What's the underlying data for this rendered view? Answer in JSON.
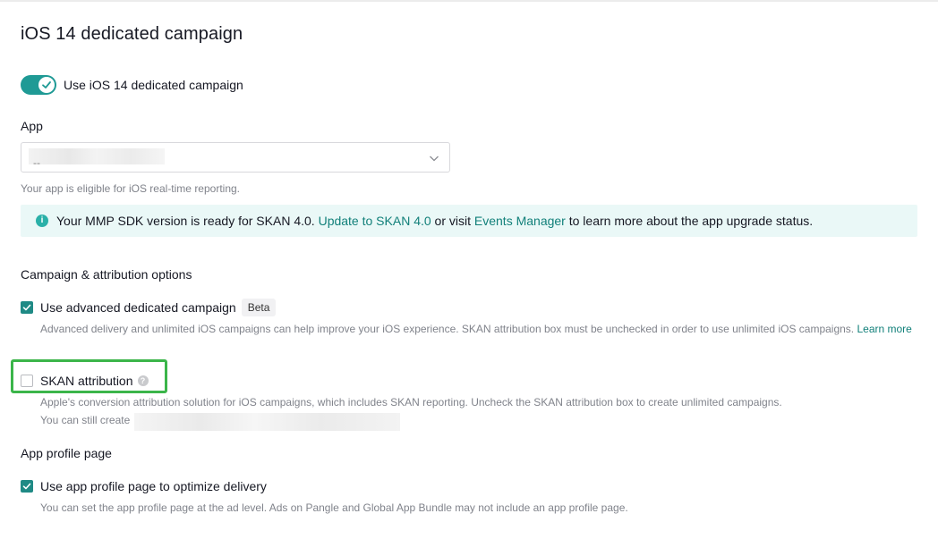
{
  "page": {
    "title": "iOS 14 dedicated campaign"
  },
  "toggle": {
    "label": "Use iOS 14 dedicated campaign",
    "on": true
  },
  "app": {
    "label": "App",
    "selected_value": "--",
    "hint": "Your app is eligible for iOS real-time reporting."
  },
  "banner": {
    "text_before": "Your MMP SDK version is ready for SKAN 4.0. ",
    "link1": "Update to SKAN 4.0",
    "text_middle": " or visit ",
    "link2": "Events Manager",
    "text_after": " to learn more about the app upgrade status."
  },
  "campaign_options": {
    "title": "Campaign & attribution options",
    "advanced": {
      "label": "Use advanced dedicated campaign",
      "badge": "Beta",
      "checked": true,
      "desc": "Advanced delivery and unlimited iOS campaigns can help improve your iOS experience. SKAN attribution box must be unchecked in order to use unlimited iOS campaigns. ",
      "learn_more": "Learn more"
    },
    "skan": {
      "label": "SKAN attribution",
      "checked": false,
      "desc1": "Apple's conversion attribution solution for iOS campaigns, which includes SKAN reporting. Uncheck the SKAN attribution box to create unlimited campaigns.",
      "desc2": "You can still create"
    }
  },
  "app_profile": {
    "title": "App profile page",
    "option": {
      "label": "Use app profile page to optimize delivery",
      "checked": true,
      "desc": "You can set the app profile page at the ad level. Ads on Pangle and Global App Bundle may not include an app profile page."
    }
  },
  "colors": {
    "accent": "#1f8a85",
    "link": "#12807a",
    "banner_bg": "#eaf8f7",
    "highlight": "#3bb54a"
  },
  "icons": {
    "toggle": "check-icon",
    "select": "chevron-down-icon",
    "banner": "info-icon",
    "help": "question-icon"
  }
}
